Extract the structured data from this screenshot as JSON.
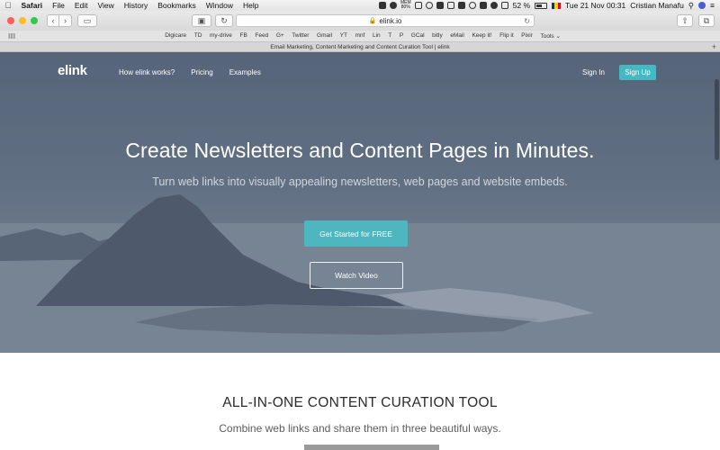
{
  "menubar": {
    "apple": "",
    "items": [
      "Safari",
      "File",
      "Edit",
      "View",
      "History",
      "Bookmarks",
      "Window",
      "Help"
    ],
    "memory": "MEM\n80%",
    "battery": "52 %",
    "datetime": "Tue 21 Nov  00:31",
    "user": "Cristian Manafu"
  },
  "toolbar": {
    "url": "elink.io",
    "back_icon": "‹",
    "forward_icon": "›",
    "sidebar_icon": "▭",
    "reload_icon": "↻"
  },
  "favorites": [
    "Digicare",
    "TD",
    "my-drive",
    "FB",
    "Feed",
    "G+",
    "Twitter",
    "Gmail",
    "YT",
    "mnf",
    "Lin",
    "T",
    "P",
    "GCal",
    "bitly",
    "eMail",
    "Keep it!",
    "Flip it",
    "Pixir",
    "Tools ⌄"
  ],
  "tab": {
    "title": "Email Marketing, Content Marketing and Content Curation Tool | elink",
    "plus": "+"
  },
  "site_nav": {
    "logo": "elink",
    "links": [
      "How elink works?",
      "Pricing",
      "Examples"
    ],
    "signin": "Sign In",
    "signup": "Sign Up"
  },
  "hero": {
    "title": "Create Newsletters and Content Pages in Minutes.",
    "subtitle": "Turn web links into visually appealing newsletters, web pages and website embeds.",
    "cta_primary": "Get Started for FREE",
    "cta_secondary": "Watch Video"
  },
  "section": {
    "heading": "ALL-IN-ONE CONTENT CURATION TOOL",
    "text": "Combine web links and share them in three beautiful ways."
  },
  "colors": {
    "accent": "#46b8c1",
    "hero_bg": "#647387",
    "close": "#fc5f57",
    "minimize": "#fdbc2e",
    "zoom": "#34c84a"
  }
}
